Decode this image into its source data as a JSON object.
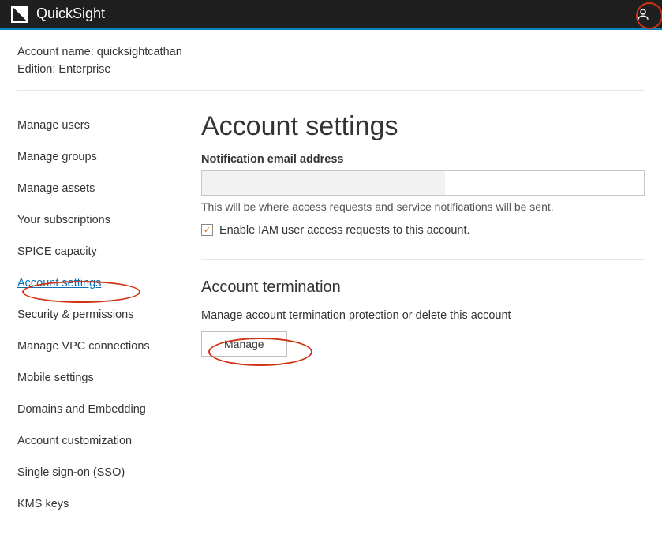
{
  "topbar": {
    "brand": "QuickSight"
  },
  "subheader": {
    "account_name_label": "Account name: ",
    "account_name_value": "quicksightcathan",
    "edition_label": "Edition: ",
    "edition_value": "Enterprise"
  },
  "sidebar": {
    "items": [
      {
        "label": "Manage users",
        "active": false
      },
      {
        "label": "Manage groups",
        "active": false
      },
      {
        "label": "Manage assets",
        "active": false
      },
      {
        "label": "Your subscriptions",
        "active": false
      },
      {
        "label": "SPICE capacity",
        "active": false
      },
      {
        "label": "Account settings",
        "active": true
      },
      {
        "label": "Security & permissions",
        "active": false
      },
      {
        "label": "Manage VPC connections",
        "active": false
      },
      {
        "label": "Mobile settings",
        "active": false
      },
      {
        "label": "Domains and Embedding",
        "active": false
      },
      {
        "label": "Account customization",
        "active": false
      },
      {
        "label": "Single sign-on (SSO)",
        "active": false
      },
      {
        "label": "KMS keys",
        "active": false
      }
    ]
  },
  "main": {
    "title": "Account settings",
    "email_label": "Notification email address",
    "email_value": "",
    "email_help": "This will be where access requests and service notifications will be sent.",
    "iam_checkbox_label": "Enable IAM user access requests to this account.",
    "iam_checkbox_checked": true,
    "termination_title": "Account termination",
    "termination_desc": "Manage account termination protection or delete this account",
    "manage_button": "Manage"
  }
}
